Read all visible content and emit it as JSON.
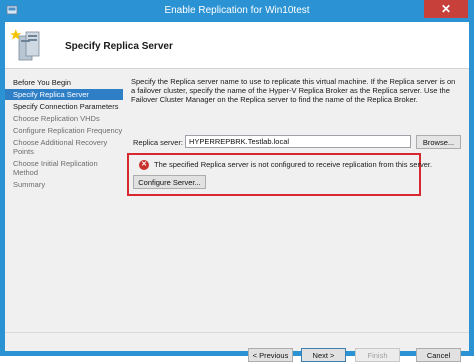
{
  "window": {
    "title": "Enable Replication for Win10test",
    "close_glyph": "✕"
  },
  "header": {
    "title": "Specify Replica Server",
    "icon": "hyper-v-replication-icon"
  },
  "nav": {
    "items": [
      {
        "label": "Before You Begin",
        "state": "done"
      },
      {
        "label": "Specify Replica Server",
        "state": "active"
      },
      {
        "label": "Specify Connection Parameters",
        "state": "done"
      },
      {
        "label": "Choose Replication VHDs",
        "state": "pending"
      },
      {
        "label": "Configure Replication Frequency",
        "state": "pending"
      },
      {
        "label": "Choose Additional Recovery Points",
        "state": "pending"
      },
      {
        "label": "Choose Initial Replication Method",
        "state": "pending"
      },
      {
        "label": "Summary",
        "state": "pending"
      }
    ]
  },
  "content": {
    "description": "Specify the Replica server name to use to replicate this virtual machine. If the Replica server is on a failover cluster, specify the name of the Hyper-V Replica Broker as the Replica server. Use the Failover Cluster Manager on the Replica server to find the name of the Replica Broker.",
    "server_label": "Replica server:",
    "server_value": "HYPERREPBRK.Testlab.local",
    "browse_label": "Browse...",
    "error_icon": "error-icon",
    "error_text": "The specified Replica server is not configured to receive replication from this server.",
    "configure_label": "Configure Server..."
  },
  "footer": {
    "previous_label": "< Previous",
    "next_label": "Next >",
    "finish_label": "Finish",
    "cancel_label": "Cancel"
  },
  "colors": {
    "titlebar": "#2b93d3",
    "nav_active": "#2f7fc7",
    "error_border": "#d7282f",
    "error_icon": "#c9302c",
    "close_button": "#c7413a"
  }
}
